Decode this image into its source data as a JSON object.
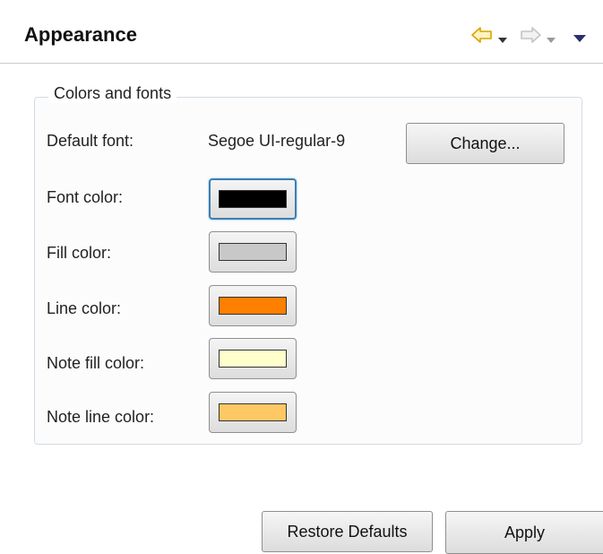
{
  "header": {
    "title": "Appearance",
    "back_icon": "back-arrow-icon",
    "forward_icon": "forward-arrow-icon",
    "menu_icon": "view-menu-icon"
  },
  "group": {
    "title": "Colors and fonts",
    "default_font_label": "Default font:",
    "default_font_value": "Segoe UI-regular-9",
    "change_button": "Change...",
    "colors": [
      {
        "label": "Font color:",
        "swatch": "#000000"
      },
      {
        "label": "Fill color:",
        "swatch": "#c8c8c8"
      },
      {
        "label": "Line color:",
        "swatch": "#ff7f00"
      },
      {
        "label": "Note fill color:",
        "swatch": "#ffffcc"
      },
      {
        "label": "Note line color:",
        "swatch": "#ffc864"
      }
    ]
  },
  "footer": {
    "restore_defaults": "Restore Defaults",
    "apply": "Apply"
  }
}
